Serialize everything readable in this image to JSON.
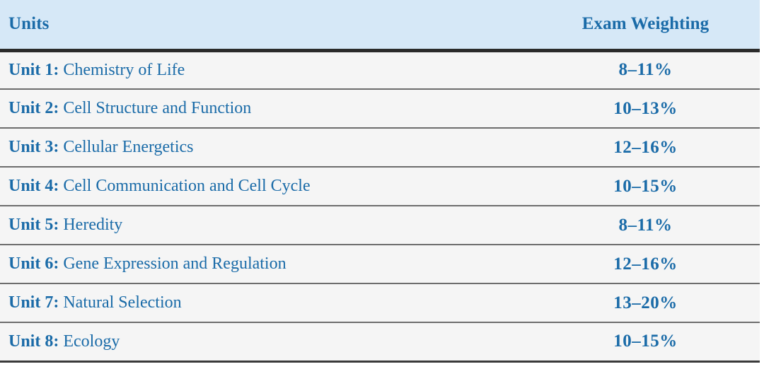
{
  "table": {
    "columns": [
      {
        "key": "units",
        "label": "Units",
        "align": "left"
      },
      {
        "key": "weighting",
        "label": "Exam Weighting",
        "align": "center"
      }
    ],
    "colors": {
      "header_background": "#d6e8f7",
      "row_background": "#f5f5f5",
      "text_blue": "#1a6ba8",
      "header_rule": "#2b2b2b",
      "row_rule": "#6d6d6d"
    },
    "rows": [
      {
        "unit_number": "Unit 1:",
        "unit_title": "Chemistry of Life",
        "weighting": "8–11%"
      },
      {
        "unit_number": "Unit 2:",
        "unit_title": "Cell Structure and Function",
        "weighting": "10–13%"
      },
      {
        "unit_number": "Unit 3:",
        "unit_title": "Cellular Energetics",
        "weighting": "12–16%"
      },
      {
        "unit_number": "Unit 4:",
        "unit_title": "Cell Communication and Cell Cycle",
        "weighting": "10–15%"
      },
      {
        "unit_number": "Unit 5:",
        "unit_title": "Heredity",
        "weighting": "8–11%"
      },
      {
        "unit_number": "Unit 6:",
        "unit_title": "Gene Expression and Regulation",
        "weighting": "12–16%"
      },
      {
        "unit_number": "Unit 7:",
        "unit_title": "Natural Selection",
        "weighting": "13–20%"
      },
      {
        "unit_number": "Unit 8:",
        "unit_title": "Ecology",
        "weighting": "10–15%"
      }
    ]
  }
}
